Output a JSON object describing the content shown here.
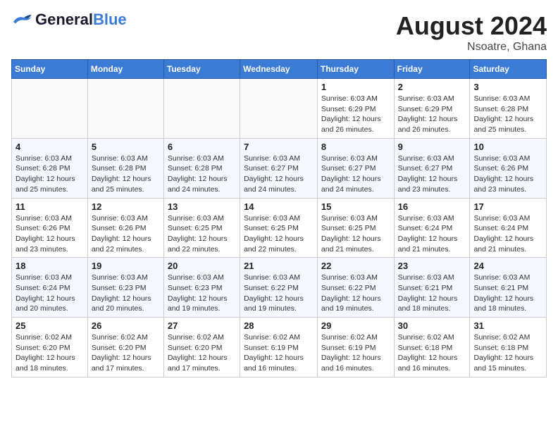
{
  "header": {
    "logo_general": "General",
    "logo_blue": "Blue",
    "month_year": "August 2024",
    "location": "Nsoatre, Ghana"
  },
  "weekdays": [
    "Sunday",
    "Monday",
    "Tuesday",
    "Wednesday",
    "Thursday",
    "Friday",
    "Saturday"
  ],
  "weeks": [
    [
      {
        "day": "",
        "info": ""
      },
      {
        "day": "",
        "info": ""
      },
      {
        "day": "",
        "info": ""
      },
      {
        "day": "",
        "info": ""
      },
      {
        "day": "1",
        "info": "Sunrise: 6:03 AM\nSunset: 6:29 PM\nDaylight: 12 hours\nand 26 minutes."
      },
      {
        "day": "2",
        "info": "Sunrise: 6:03 AM\nSunset: 6:29 PM\nDaylight: 12 hours\nand 26 minutes."
      },
      {
        "day": "3",
        "info": "Sunrise: 6:03 AM\nSunset: 6:28 PM\nDaylight: 12 hours\nand 25 minutes."
      }
    ],
    [
      {
        "day": "4",
        "info": "Sunrise: 6:03 AM\nSunset: 6:28 PM\nDaylight: 12 hours\nand 25 minutes."
      },
      {
        "day": "5",
        "info": "Sunrise: 6:03 AM\nSunset: 6:28 PM\nDaylight: 12 hours\nand 25 minutes."
      },
      {
        "day": "6",
        "info": "Sunrise: 6:03 AM\nSunset: 6:28 PM\nDaylight: 12 hours\nand 24 minutes."
      },
      {
        "day": "7",
        "info": "Sunrise: 6:03 AM\nSunset: 6:27 PM\nDaylight: 12 hours\nand 24 minutes."
      },
      {
        "day": "8",
        "info": "Sunrise: 6:03 AM\nSunset: 6:27 PM\nDaylight: 12 hours\nand 24 minutes."
      },
      {
        "day": "9",
        "info": "Sunrise: 6:03 AM\nSunset: 6:27 PM\nDaylight: 12 hours\nand 23 minutes."
      },
      {
        "day": "10",
        "info": "Sunrise: 6:03 AM\nSunset: 6:26 PM\nDaylight: 12 hours\nand 23 minutes."
      }
    ],
    [
      {
        "day": "11",
        "info": "Sunrise: 6:03 AM\nSunset: 6:26 PM\nDaylight: 12 hours\nand 23 minutes."
      },
      {
        "day": "12",
        "info": "Sunrise: 6:03 AM\nSunset: 6:26 PM\nDaylight: 12 hours\nand 22 minutes."
      },
      {
        "day": "13",
        "info": "Sunrise: 6:03 AM\nSunset: 6:25 PM\nDaylight: 12 hours\nand 22 minutes."
      },
      {
        "day": "14",
        "info": "Sunrise: 6:03 AM\nSunset: 6:25 PM\nDaylight: 12 hours\nand 22 minutes."
      },
      {
        "day": "15",
        "info": "Sunrise: 6:03 AM\nSunset: 6:25 PM\nDaylight: 12 hours\nand 21 minutes."
      },
      {
        "day": "16",
        "info": "Sunrise: 6:03 AM\nSunset: 6:24 PM\nDaylight: 12 hours\nand 21 minutes."
      },
      {
        "day": "17",
        "info": "Sunrise: 6:03 AM\nSunset: 6:24 PM\nDaylight: 12 hours\nand 21 minutes."
      }
    ],
    [
      {
        "day": "18",
        "info": "Sunrise: 6:03 AM\nSunset: 6:24 PM\nDaylight: 12 hours\nand 20 minutes."
      },
      {
        "day": "19",
        "info": "Sunrise: 6:03 AM\nSunset: 6:23 PM\nDaylight: 12 hours\nand 20 minutes."
      },
      {
        "day": "20",
        "info": "Sunrise: 6:03 AM\nSunset: 6:23 PM\nDaylight: 12 hours\nand 19 minutes."
      },
      {
        "day": "21",
        "info": "Sunrise: 6:03 AM\nSunset: 6:22 PM\nDaylight: 12 hours\nand 19 minutes."
      },
      {
        "day": "22",
        "info": "Sunrise: 6:03 AM\nSunset: 6:22 PM\nDaylight: 12 hours\nand 19 minutes."
      },
      {
        "day": "23",
        "info": "Sunrise: 6:03 AM\nSunset: 6:21 PM\nDaylight: 12 hours\nand 18 minutes."
      },
      {
        "day": "24",
        "info": "Sunrise: 6:03 AM\nSunset: 6:21 PM\nDaylight: 12 hours\nand 18 minutes."
      }
    ],
    [
      {
        "day": "25",
        "info": "Sunrise: 6:02 AM\nSunset: 6:20 PM\nDaylight: 12 hours\nand 18 minutes."
      },
      {
        "day": "26",
        "info": "Sunrise: 6:02 AM\nSunset: 6:20 PM\nDaylight: 12 hours\nand 17 minutes."
      },
      {
        "day": "27",
        "info": "Sunrise: 6:02 AM\nSunset: 6:20 PM\nDaylight: 12 hours\nand 17 minutes."
      },
      {
        "day": "28",
        "info": "Sunrise: 6:02 AM\nSunset: 6:19 PM\nDaylight: 12 hours\nand 16 minutes."
      },
      {
        "day": "29",
        "info": "Sunrise: 6:02 AM\nSunset: 6:19 PM\nDaylight: 12 hours\nand 16 minutes."
      },
      {
        "day": "30",
        "info": "Sunrise: 6:02 AM\nSunset: 6:18 PM\nDaylight: 12 hours\nand 16 minutes."
      },
      {
        "day": "31",
        "info": "Sunrise: 6:02 AM\nSunset: 6:18 PM\nDaylight: 12 hours\nand 15 minutes."
      }
    ]
  ]
}
